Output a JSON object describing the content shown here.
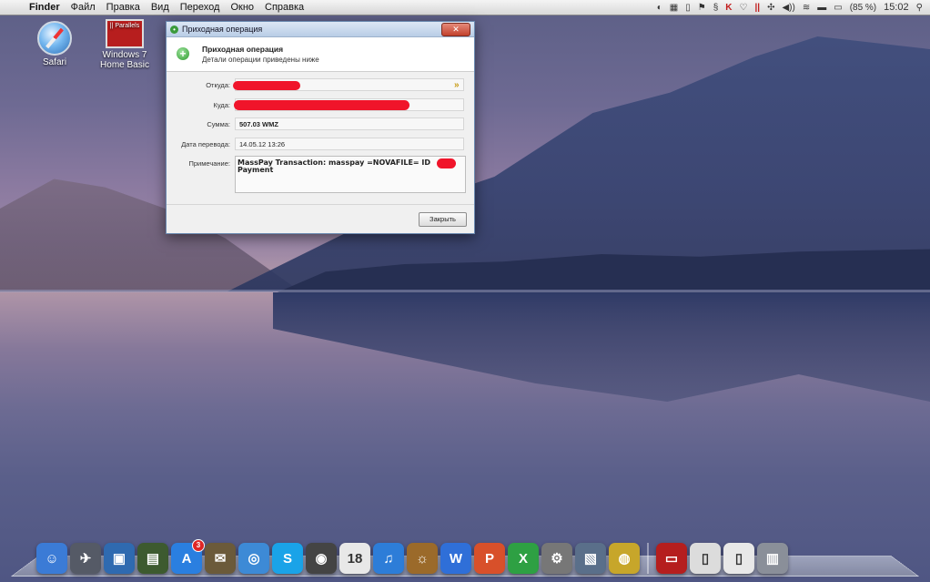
{
  "menubar": {
    "app_name": "Finder",
    "items": [
      "Файл",
      "Правка",
      "Вид",
      "Переход",
      "Окно",
      "Справка"
    ],
    "battery": "(85 %)",
    "clock": "15:02"
  },
  "desktop_icons": [
    {
      "label": "Safari",
      "icon": "safari-icon"
    },
    {
      "label_line1": "Windows 7",
      "label_line2": "Home Basic",
      "icon": "parallels-vm-icon",
      "logo_text": "|| Parallels"
    }
  ],
  "dialog": {
    "title": "Приходная операция",
    "header_title": "Приходная операция",
    "header_subtitle": "Детали операции приведены ниже",
    "fields": {
      "from_label": "Откуда:",
      "to_label": "Куда:",
      "amount_label": "Сумма:",
      "amount_value": "507.03 WMZ",
      "date_label": "Дата перевода:",
      "date_value": "14.05.12 13:26",
      "note_label": "Примечание:",
      "note_line1": "MassPay Transaction: masspay =NOVAFILE= ID",
      "note_line2": "Payment"
    },
    "close_button": "Закрыть"
  },
  "dock": {
    "items": [
      {
        "name": "finder-icon",
        "glyph": "☺",
        "color": "#3b7bd6"
      },
      {
        "name": "launchpad-icon",
        "glyph": "✈",
        "color": "#555a66"
      },
      {
        "name": "parallels-desktop-icon",
        "glyph": "▣",
        "color": "#2f6ab0"
      },
      {
        "name": "utility-icon",
        "glyph": "▤",
        "color": "#3d5a2f"
      },
      {
        "name": "app-store-icon",
        "glyph": "A",
        "color": "#2a7fe0",
        "badge": "3"
      },
      {
        "name": "mail-bird-icon",
        "glyph": "✉",
        "color": "#6b5a3a"
      },
      {
        "name": "safari-dock-icon",
        "glyph": "◎",
        "color": "#3d8ad6"
      },
      {
        "name": "skype-icon",
        "glyph": "S",
        "color": "#1aa3e8"
      },
      {
        "name": "facetime-icon",
        "glyph": "◉",
        "color": "#444"
      },
      {
        "name": "calendar-icon",
        "glyph": "18",
        "color": "#e8e8e8"
      },
      {
        "name": "itunes-icon",
        "glyph": "♫",
        "color": "#2d7dd8"
      },
      {
        "name": "photo-icon",
        "glyph": "☼",
        "color": "#9b6a2a"
      },
      {
        "name": "word-icon",
        "glyph": "W",
        "color": "#2f6fd8"
      },
      {
        "name": "powerpoint-icon",
        "glyph": "P",
        "color": "#d8502a"
      },
      {
        "name": "excel-icon",
        "glyph": "X",
        "color": "#2ea043"
      },
      {
        "name": "system-preferences-icon",
        "glyph": "⚙",
        "color": "#777"
      },
      {
        "name": "preview-icon",
        "glyph": "▧",
        "color": "#5a6f8a"
      },
      {
        "name": "webcam-icon",
        "glyph": "◍",
        "color": "#c7a62a"
      },
      {
        "name": "parallels-vm-dock-icon",
        "glyph": "▭",
        "color": "#b51e1e"
      },
      {
        "name": "txt-file-icon",
        "glyph": "▯",
        "color": "#dcdcdc"
      },
      {
        "name": "document-icon",
        "glyph": "▯",
        "color": "#e8e8e8"
      },
      {
        "name": "trash-icon",
        "glyph": "▥",
        "color": "#8a8f99"
      }
    ]
  }
}
